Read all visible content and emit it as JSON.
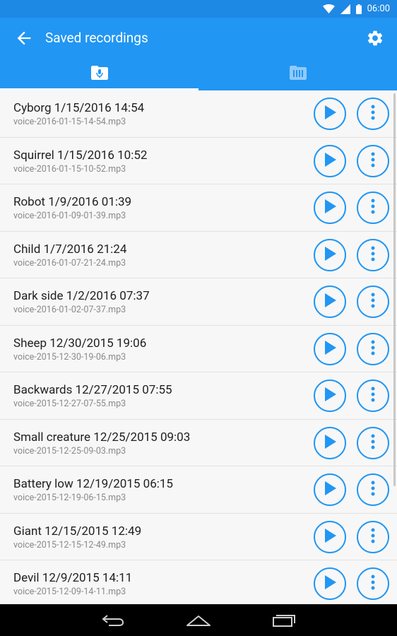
{
  "status_bar": {
    "time": "06:00"
  },
  "app_bar": {
    "title": "Saved recordings"
  },
  "tabs": [
    {
      "icon": "recordings-folder-icon",
      "active": true
    },
    {
      "icon": "archive-icon",
      "active": false
    }
  ],
  "recordings": [
    {
      "title": "Cyborg 1/15/2016 14:54",
      "file": "voice-2016-01-15-14-54.mp3"
    },
    {
      "title": "Squirrel 1/15/2016 10:52",
      "file": "voice-2016-01-15-10-52.mp3"
    },
    {
      "title": "Robot 1/9/2016 01:39",
      "file": "voice-2016-01-09-01-39.mp3"
    },
    {
      "title": "Child 1/7/2016 21:24",
      "file": "voice-2016-01-07-21-24.mp3"
    },
    {
      "title": "Dark side 1/2/2016 07:37",
      "file": "voice-2016-01-02-07-37.mp3"
    },
    {
      "title": "Sheep 12/30/2015 19:06",
      "file": "voice-2015-12-30-19-06.mp3"
    },
    {
      "title": "Backwards 12/27/2015 07:55",
      "file": "voice-2015-12-27-07-55.mp3"
    },
    {
      "title": "Small creature 12/25/2015 09:03",
      "file": "voice-2015-12-25-09-03.mp3"
    },
    {
      "title": "Battery low 12/19/2015 06:15",
      "file": "voice-2015-12-19-06-15.mp3"
    },
    {
      "title": "Giant 12/15/2015 12:49",
      "file": "voice-2015-12-15-12-49.mp3"
    },
    {
      "title": "Devil 12/9/2015 14:11",
      "file": "voice-2015-12-09-14-11.mp3"
    }
  ],
  "colors": {
    "primary": "#2196f3",
    "primary_dark": "#1e88e5",
    "accent": "#2196f3"
  }
}
